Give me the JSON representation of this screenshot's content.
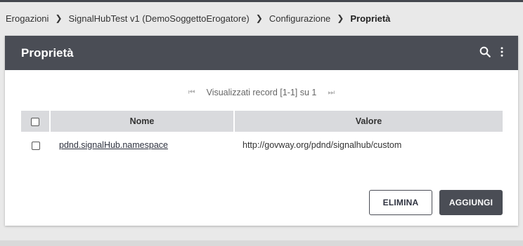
{
  "breadcrumb": {
    "items": [
      "Erogazioni",
      "SignalHubTest v1 (DemoSoggettoErogatore)",
      "Configurazione"
    ],
    "current": "Proprietà"
  },
  "panel": {
    "title": "Proprietà",
    "icons": [
      "search-icon",
      "more-vert-icon"
    ]
  },
  "pager": {
    "text": "Visualizzati record [1-1] su 1",
    "first_icon": "first-page-icon",
    "last_icon": "last-page-icon"
  },
  "table": {
    "columns": [
      "Nome",
      "Valore"
    ],
    "rows": [
      {
        "nome": "pdnd.signalHub.namespace",
        "valore": "http://govway.org/pdnd/signalhub/custom"
      }
    ]
  },
  "actions": {
    "delete_label": "ELIMINA",
    "add_label": "AGGIUNGI"
  },
  "colors": {
    "header_bg": "#4a4d55",
    "table_header_bg": "#d9dadd",
    "page_bg": "#e9e9e9"
  }
}
